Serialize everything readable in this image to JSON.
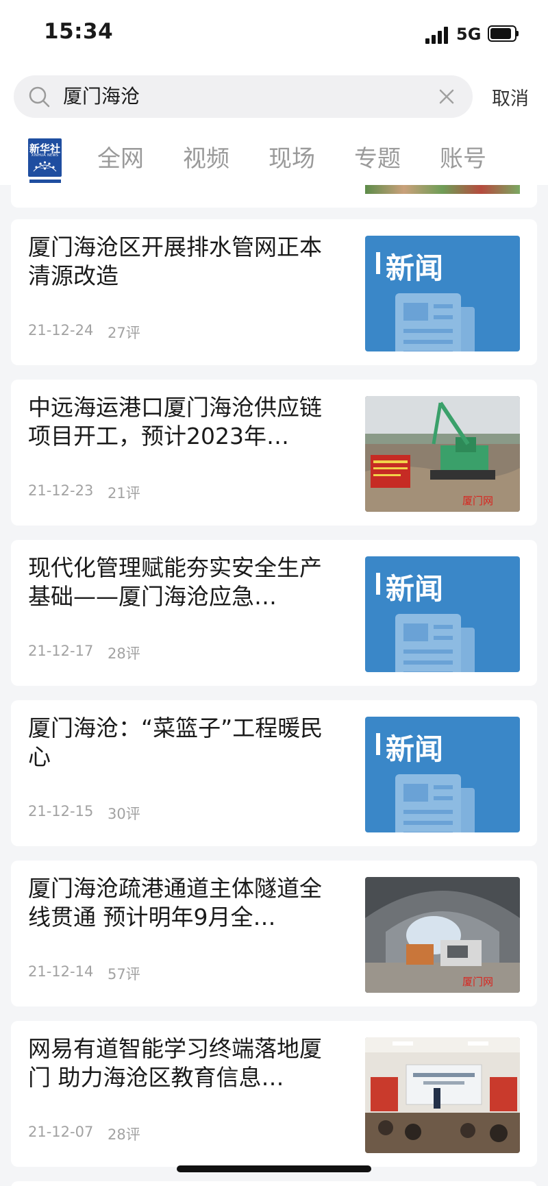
{
  "status_bar": {
    "time": "15:34",
    "network": "5G"
  },
  "search": {
    "query": "厦门海沧",
    "cancel_label": "取消"
  },
  "tabs": [
    {
      "label": "全网"
    },
    {
      "label": "视频"
    },
    {
      "label": "现场"
    },
    {
      "label": "专题"
    },
    {
      "label": "账号"
    }
  ],
  "logo": {
    "text": "新华社",
    "subtext": "XINHUA NEWS"
  },
  "placeholder_badge": "新闻",
  "results": [
    {
      "title": "厦门海沧区开展排水管网正本清源改造",
      "date": "21-12-24",
      "comments": "27评",
      "thumb": "news-placeholder"
    },
    {
      "title": "中远海运港口厦门海沧供应链项目开工，预计2023年…",
      "date": "21-12-23",
      "comments": "21评",
      "thumb": "photo-excavator",
      "photo_caption": "厦门网"
    },
    {
      "title": "现代化管理赋能夯实安全生产基础——厦门海沧应急…",
      "date": "21-12-17",
      "comments": "28评",
      "thumb": "news-placeholder"
    },
    {
      "title": "厦门海沧：“菜篮子”工程暖民心",
      "date": "21-12-15",
      "comments": "30评",
      "thumb": "news-placeholder"
    },
    {
      "title": "厦门海沧疏港通道主体隧道全线贯通  预计明年9月全…",
      "date": "21-12-14",
      "comments": "57评",
      "thumb": "photo-tunnel",
      "photo_caption": "厦门网"
    },
    {
      "title": "网易有道智能学习终端落地厦门 助力海沧区教育信息…",
      "date": "21-12-07",
      "comments": "28评",
      "thumb": "photo-meeting"
    }
  ]
}
